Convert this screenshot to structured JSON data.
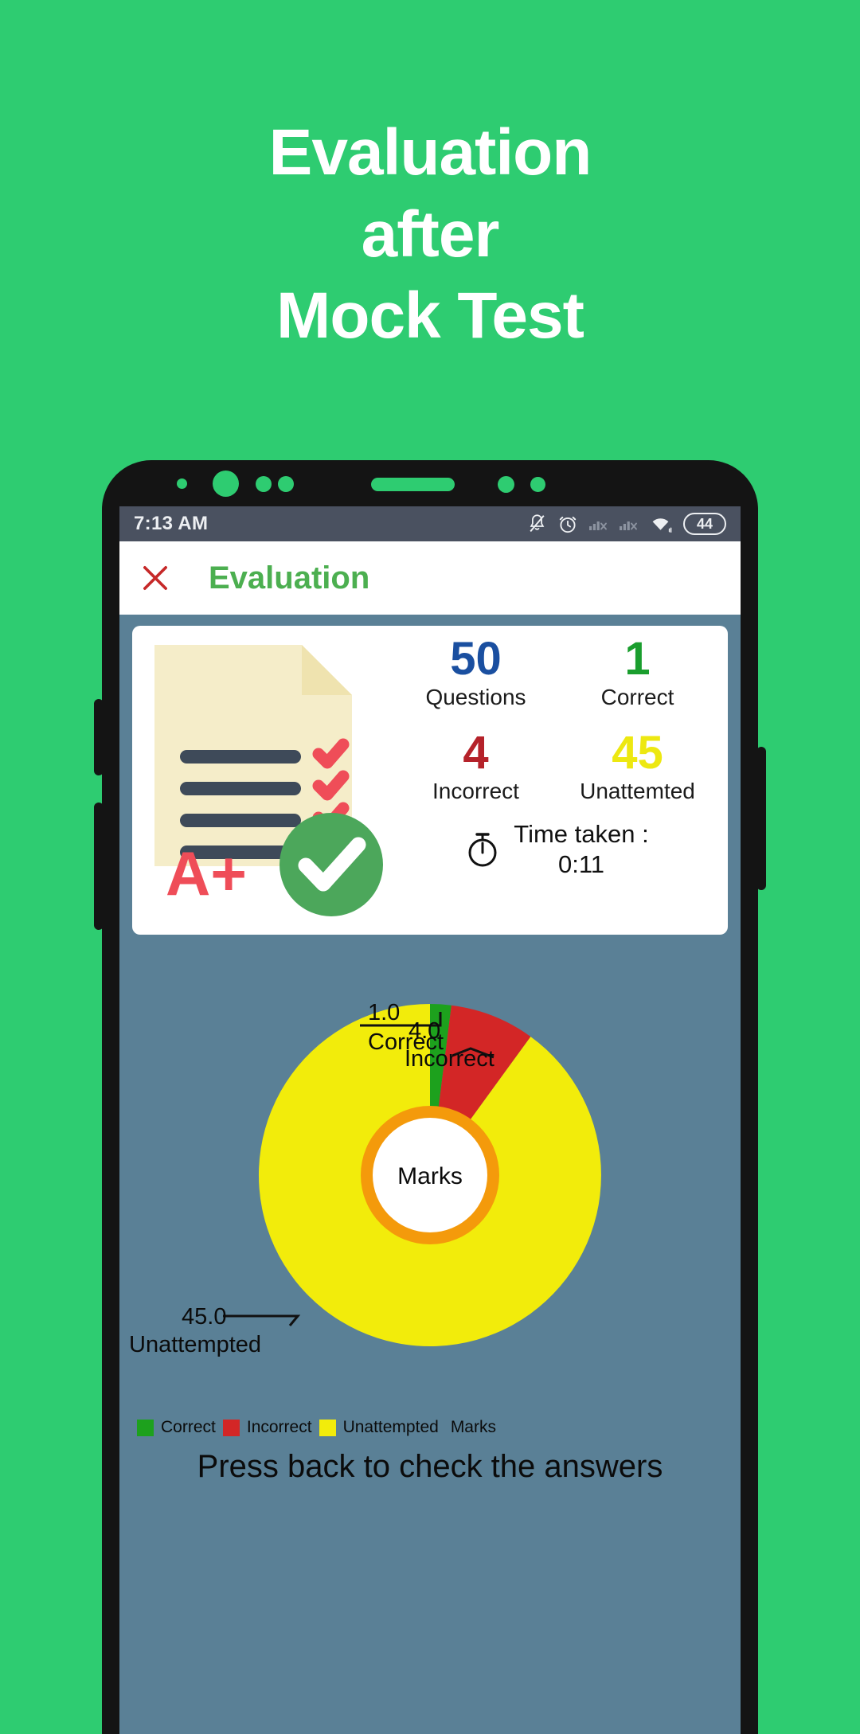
{
  "promo": {
    "lines": [
      "Evaluation",
      "after",
      "Mock Test"
    ],
    "background_color": "#2ECC71",
    "text_color": "#FFFFFF"
  },
  "phone": {
    "frame_color": "#141414",
    "notch_accent_color": "#2ECC71"
  },
  "statusbar": {
    "time": "7:13 AM",
    "battery_level": "44",
    "background_color": "#4A5160",
    "icons": [
      "bell-muted-icon",
      "alarm-clock-icon",
      "signal-no-sim-1-icon",
      "signal-no-sim-2-icon",
      "wifi-icon",
      "battery-icon"
    ]
  },
  "appbar": {
    "close_label": "close-icon",
    "title": "Evaluation",
    "title_color": "#4CAF50",
    "close_color": "#C62828",
    "background_color": "#FFFFFF"
  },
  "card": {
    "background_color": "#FFFFFF",
    "illustration": {
      "name": "exam-paper-with-checkmarks",
      "grade_text": "A+",
      "paper_color": "#F5EDC9",
      "line_color": "#3E4A59",
      "check_color": "#EF4D58",
      "badge_color": "#4CA75B"
    },
    "stats": [
      {
        "value": "50",
        "label": "Questions",
        "color": "#1A4FA0"
      },
      {
        "value": "1",
        "label": "Correct",
        "color": "#1A9E2E"
      },
      {
        "value": "4",
        "label": "Incorrect",
        "color": "#B5222A"
      },
      {
        "value": "45",
        "label": "Unattemted",
        "color": "#EDE811"
      }
    ],
    "time": {
      "icon": "stopwatch-icon",
      "label": "Time taken :",
      "value": "0:11"
    }
  },
  "chart_data": {
    "type": "pie",
    "title": "Marks",
    "center_label": "Marks",
    "center_ring_color": "#F49A0B",
    "background_color": "#5A8096",
    "categories": [
      "Correct",
      "Incorrect",
      "Unattempted"
    ],
    "values": [
      1.0,
      4.0,
      45.0
    ],
    "value_labels": [
      "1.0",
      "4.0",
      "45.0"
    ],
    "colors": [
      "#1DA11D",
      "#D32626",
      "#F2EC0B"
    ],
    "legend": {
      "position": "bottom-left",
      "entries": [
        {
          "label": "Correct",
          "color": "#1DA11D"
        },
        {
          "label": "Incorrect",
          "color": "#D32626"
        },
        {
          "label": "Unattempted",
          "color": "#F2EC0B"
        }
      ],
      "series_name": "Marks"
    },
    "annotations": [
      {
        "text": "1.0",
        "series": "Correct"
      },
      {
        "text": "Correct",
        "series": "Correct"
      },
      {
        "text": "4.0",
        "series": "Incorrect"
      },
      {
        "text": "Incorrect",
        "series": "Incorrect"
      },
      {
        "text": "45.0",
        "series": "Unattempted"
      },
      {
        "text": "Unattempted",
        "series": "Unattempted"
      }
    ],
    "donut": true
  },
  "footer": {
    "note": "Press back to check the answers"
  }
}
